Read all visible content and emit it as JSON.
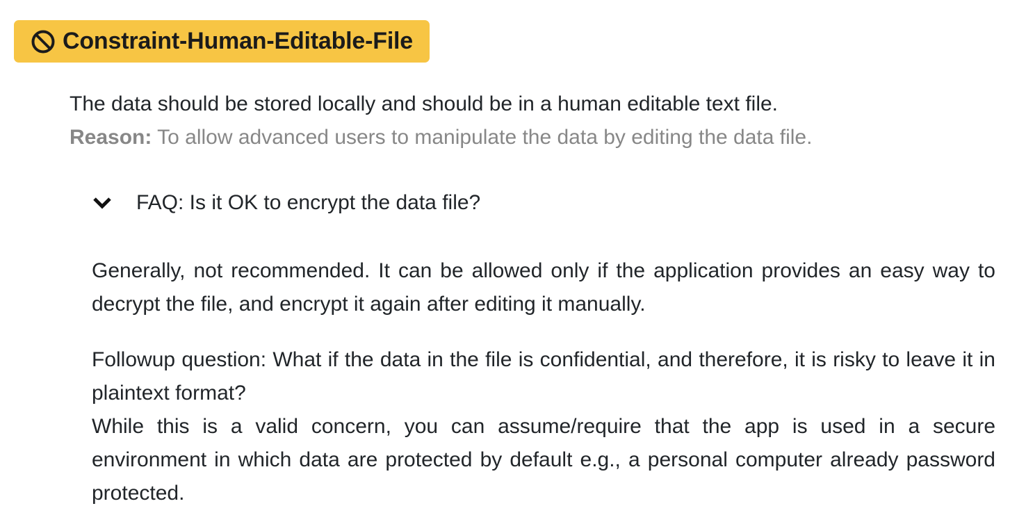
{
  "badge": {
    "icon": "prohibited-icon",
    "title": "Constraint-Human-Editable-File",
    "color": "#f7c544"
  },
  "description": {
    "text": "The data should be stored locally and should be in a human editable text file.",
    "reason_label": "Reason:",
    "reason_text": " To allow advanced users to manipulate the data by editing the data file."
  },
  "faq": {
    "toggle_icon": "chevron-down-icon",
    "question": "FAQ: Is it OK to encrypt the data file?",
    "answer": "Generally, not recommended. It can be allowed only if the application provides an easy way to decrypt the file, and encrypt it again after editing it manually.",
    "followup_question": "Followup question: What if the data in the file is confidential, and therefore, it is risky to leave it in plaintext format?",
    "followup_answer": "While this is a valid concern, you can assume/require that the app is used in a secure environment in which data are protected by default e.g., a personal computer already password protected."
  }
}
